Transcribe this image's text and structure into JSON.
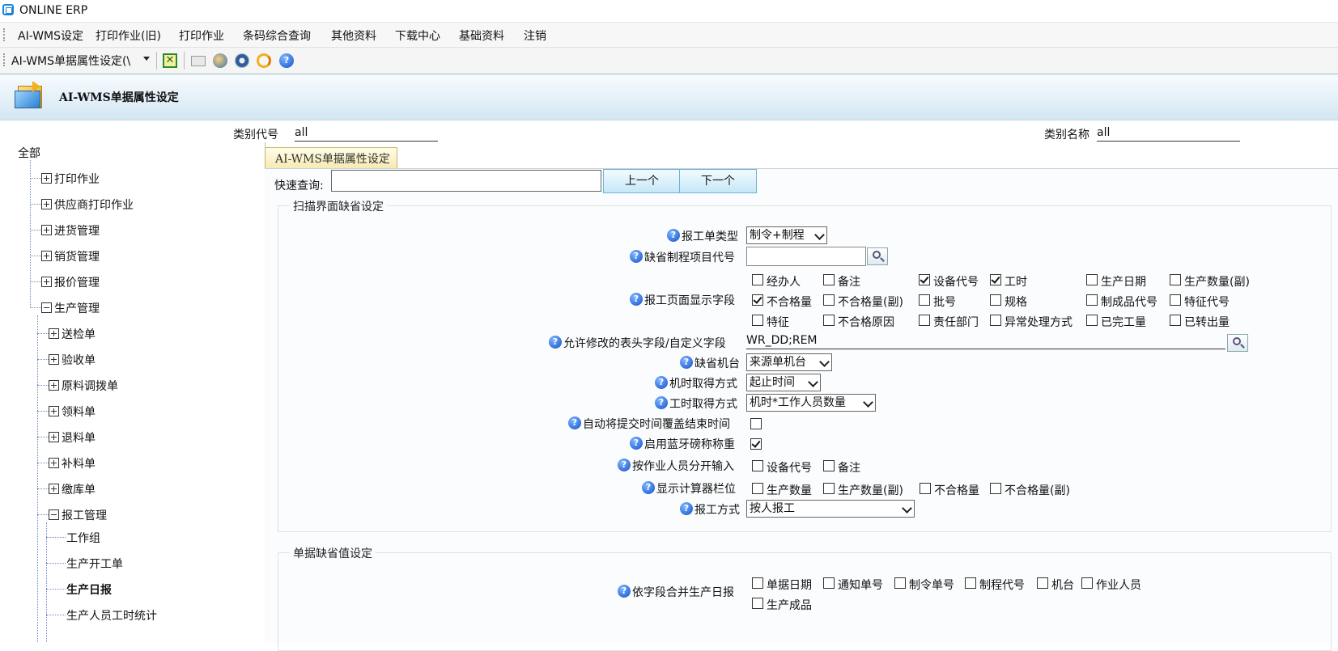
{
  "window": {
    "title": "ONLINE ERP"
  },
  "menu": [
    "AI-WMS设定",
    "打印作业(旧)",
    "打印作业",
    "条码综合查询",
    "其他资料",
    "下载中心",
    "基础资料",
    "注销"
  ],
  "toolbar": {
    "module_select": "AI-WMS单据属性设定(\\"
  },
  "module": {
    "title": "AI-WMS单据属性设定"
  },
  "filter": {
    "category_code_label": "类别代号",
    "category_code_value": "all",
    "category_name_label": "类别名称",
    "category_name_value": "all"
  },
  "tree": {
    "root": "全部",
    "level1": [
      "打印作业",
      "供应商打印作业",
      "进货管理",
      "销货管理",
      "报价管理",
      "生产管理"
    ],
    "level2": [
      "送检单",
      "验收单",
      "原料调拨单",
      "领料单",
      "退料单",
      "补料单",
      "缴库单",
      "报工管理"
    ],
    "level3": [
      "工作组",
      "生产开工单",
      "生产日报",
      "生产人员工时统计"
    ]
  },
  "tab": {
    "label": "AI-WMS单据属性设定"
  },
  "search": {
    "label": "快速查询:",
    "value": "",
    "prev": "上一个",
    "next": "下一个"
  },
  "scan_section": {
    "legend": "扫描界面缺省设定",
    "report_type": {
      "label": "报工单类型",
      "value": "制令+制程"
    },
    "default_process_code": {
      "label": "缺省制程项目代号",
      "value": ""
    },
    "display_fields": {
      "label": "报工页面显示字段",
      "options": [
        {
          "text": "经办人",
          "checked": false
        },
        {
          "text": "备注",
          "checked": false
        },
        {
          "text": "设备代号",
          "checked": true
        },
        {
          "text": "工时",
          "checked": true
        },
        {
          "text": "生产日期",
          "checked": false
        },
        {
          "text": "生产数量(副)",
          "checked": false
        },
        {
          "text": "不合格量",
          "checked": true
        },
        {
          "text": "不合格量(副)",
          "checked": false
        },
        {
          "text": "批号",
          "checked": false
        },
        {
          "text": "规格",
          "checked": false
        },
        {
          "text": "制成品代号",
          "checked": false
        },
        {
          "text": "特征代号",
          "checked": false
        },
        {
          "text": "特征",
          "checked": false
        },
        {
          "text": "不合格原因",
          "checked": false
        },
        {
          "text": "责任部门",
          "checked": false
        },
        {
          "text": "异常处理方式",
          "checked": false
        },
        {
          "text": "已完工量",
          "checked": false
        },
        {
          "text": "已转出量",
          "checked": false
        }
      ]
    },
    "editable_fields": {
      "label": "允许修改的表头字段/自定义字段",
      "value": "WR_DD;REM"
    },
    "default_machine": {
      "label": "缺省机台",
      "value": "来源单机台"
    },
    "machine_time_method": {
      "label": "机时取得方式",
      "value": "起止时间"
    },
    "work_time_method": {
      "label": "工时取得方式",
      "value": "机时*工作人员数量"
    },
    "auto_override_end": {
      "label": "自动将提交时间覆盖结束时间",
      "checked": false
    },
    "bluetooth_scale": {
      "label": "启用蓝牙磅称称重",
      "checked": true
    },
    "split_by_worker": {
      "label": "按作业人员分开输入",
      "options": [
        {
          "text": "设备代号",
          "checked": false
        },
        {
          "text": "备注",
          "checked": false
        }
      ]
    },
    "calculator_fields": {
      "label": "显示计算器栏位",
      "options": [
        {
          "text": "生产数量",
          "checked": false
        },
        {
          "text": "生产数量(副)",
          "checked": false
        },
        {
          "text": "不合格量",
          "checked": false
        },
        {
          "text": "不合格量(副)",
          "checked": false
        }
      ]
    },
    "report_mode": {
      "label": "报工方式",
      "value": "按人报工"
    }
  },
  "doc_section": {
    "legend": "单据缺省值设定",
    "merge_fields": {
      "label": "依字段合并生产日报",
      "options": [
        {
          "text": "单据日期",
          "checked": false
        },
        {
          "text": "通知单号",
          "checked": false
        },
        {
          "text": "制令单号",
          "checked": false
        },
        {
          "text": "制程代号",
          "checked": false
        },
        {
          "text": "机台",
          "checked": false
        },
        {
          "text": "作业人员",
          "checked": false
        },
        {
          "text": "生产成品",
          "checked": false
        }
      ]
    }
  }
}
